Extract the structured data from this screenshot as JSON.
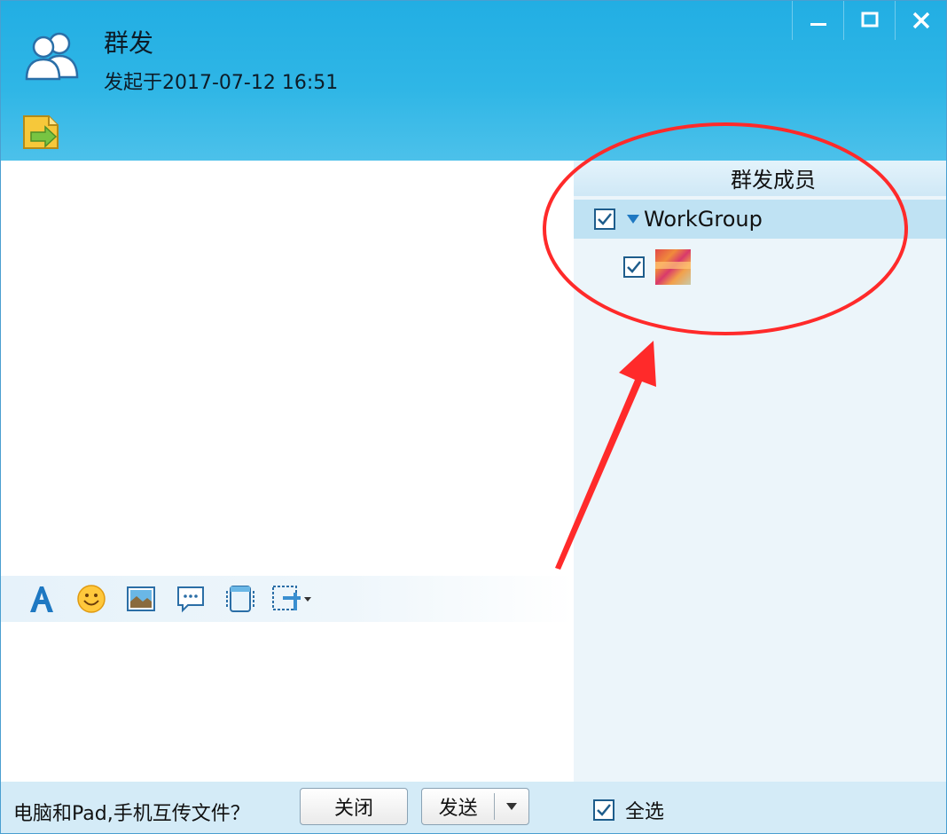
{
  "window": {
    "title": "群发",
    "subtitle": "发起于2017-07-12 16:51",
    "accent_color": "#22aee3"
  },
  "window_controls": [
    "minimize-icon",
    "maximize-icon",
    "close-icon"
  ],
  "header_tools": [
    "send-file-icon"
  ],
  "editor_toolbar": {
    "tools": [
      "font-icon",
      "emoji-icon",
      "image-icon",
      "chat-bubble-icon",
      "screenshot-icon",
      "screen-capture-dropdown-icon"
    ]
  },
  "members_panel": {
    "header": "群发成员",
    "group": {
      "name": "WorkGroup",
      "checked": true,
      "expanded": true
    },
    "members": [
      {
        "checked": true
      }
    ]
  },
  "bottom_bar": {
    "transfer_link": "电脑和Pad,手机互传文件？",
    "close_label": "关闭",
    "send_label": "发送",
    "select_all_label": "全选",
    "select_all_checked": true
  },
  "annotation": {
    "color": "#ff2a2a"
  }
}
